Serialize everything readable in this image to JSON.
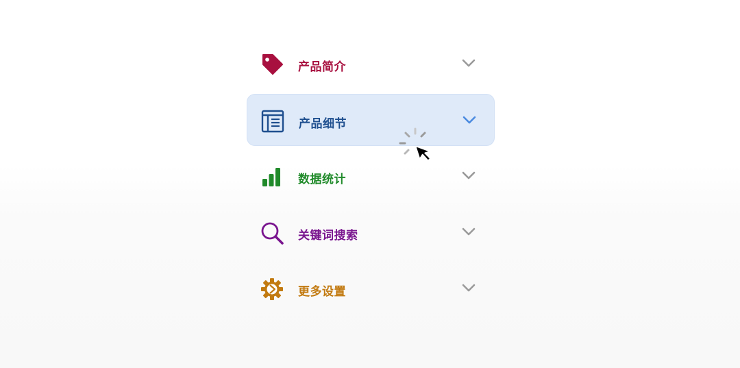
{
  "accordion": {
    "items": [
      {
        "label": "产品简介",
        "icon": "tag-icon",
        "color": "#a8103f",
        "active": false
      },
      {
        "label": "产品细节",
        "icon": "document-list-icon",
        "color": "#1f4f8f",
        "active": true
      },
      {
        "label": "数据统计",
        "icon": "bar-chart-icon",
        "color": "#208a2a",
        "active": false
      },
      {
        "label": "关键词搜索",
        "icon": "search-icon",
        "color": "#7a168f",
        "active": false
      },
      {
        "label": "更多设置",
        "icon": "gear-icon",
        "color": "#c27a10",
        "active": false
      }
    ],
    "chevron_color": "#9a9a9a",
    "active_chevron_color": "#4a8ae0",
    "active_background": "#dfeaf9"
  },
  "cursor": {
    "type": "loading-pointer",
    "icons": [
      "loading-spinner-icon",
      "mouse-pointer-icon"
    ]
  }
}
